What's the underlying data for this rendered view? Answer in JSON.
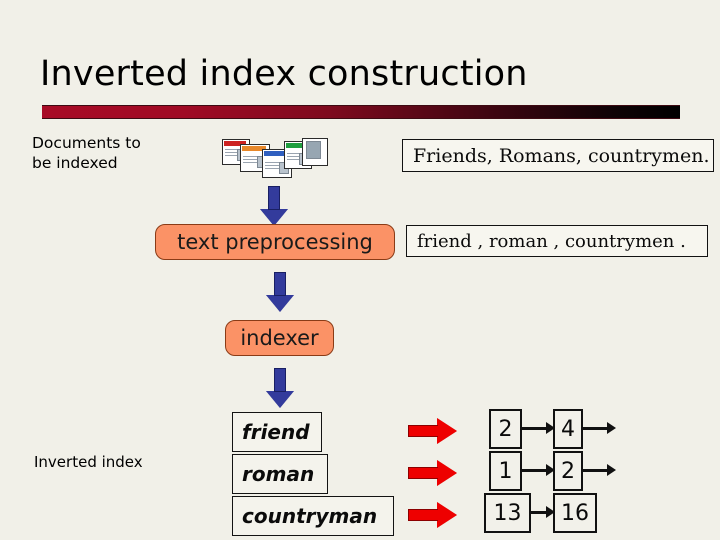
{
  "slide": {
    "title": "Inverted index construction",
    "background_color": "#f1f0e8",
    "rule_gradient_from": "#a80b26",
    "rule_gradient_to": "#000000"
  },
  "labels": {
    "documents": "Documents to\nbe indexed",
    "inverted_index": "Inverted index"
  },
  "stages": {
    "text_preprocessing": "text preprocessing",
    "indexer": "indexer"
  },
  "text_samples": {
    "original": "Friends, Romans, countrymen.",
    "tokenized": "friend , roman , countrymen ."
  },
  "dictionary": [
    {
      "term": "friend",
      "postings": [
        "2",
        "4"
      ],
      "has_trailing_arrow": true
    },
    {
      "term": "roman",
      "postings": [
        "1",
        "2"
      ],
      "has_trailing_arrow": true
    },
    {
      "term": "countryman",
      "postings": [
        "13",
        "16"
      ],
      "has_trailing_arrow": false
    }
  ],
  "colors": {
    "stage_box": "#fb9266",
    "flow_arrow": "#333b9c",
    "posting_arrow": "#ee0000"
  },
  "documents_icon": {
    "name": "document-stack-icon",
    "page_count": 5,
    "band_colors": [
      "#cc2222",
      "#e8882a",
      "#2f5fc0",
      "#1f9e3e",
      "#8a9aa8"
    ]
  }
}
